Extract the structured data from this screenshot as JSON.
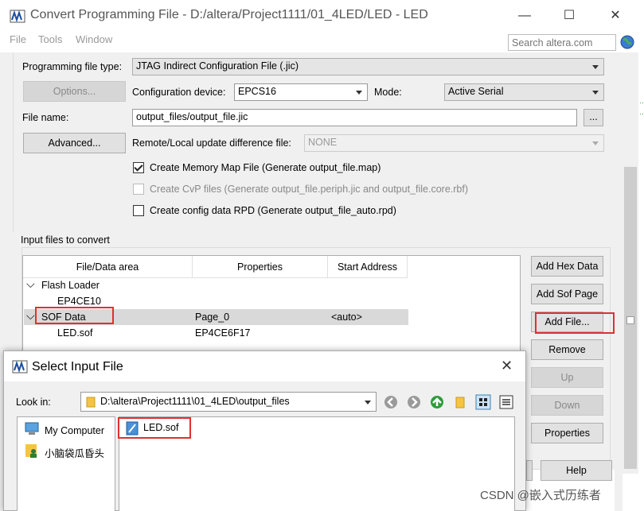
{
  "window": {
    "title": "Convert Programming File - D:/altera/Project1111/01_4LED/LED - LED",
    "minimize": "—",
    "maximize": "☐",
    "close": "✕"
  },
  "menu": {
    "file": "File",
    "tools": "Tools",
    "window": "Window",
    "search_placeholder": "Search altera.com"
  },
  "output": {
    "programming_file_type_label": "Programming file type:",
    "programming_file_type_value": "JTAG Indirect Configuration File (.jic)",
    "options_button": "Options...",
    "config_device_label": "Configuration device:",
    "config_device_value": "EPCS16",
    "mode_label": "Mode:",
    "mode_value": "Active Serial",
    "file_name_label": "File name:",
    "file_name_value": "output_files/output_file.jic",
    "browse_button": "...",
    "advanced_button": "Advanced...",
    "remote_label": "Remote/Local update difference file:",
    "remote_value": "NONE",
    "chk_memory_map": "Create Memory Map File (Generate output_file.map)",
    "chk_cvp": "Create CvP files (Generate output_file.periph.jic and output_file.core.rbf)",
    "chk_rpd": "Create config data RPD (Generate output_file_auto.rpd)"
  },
  "input": {
    "group_label": "Input files to convert",
    "columns": [
      "File/Data area",
      "Properties",
      "Start Address"
    ],
    "rows": [
      {
        "name": "Flash Loader",
        "props": "",
        "addr": "",
        "expand": "⌵"
      },
      {
        "name": "EP4CE10",
        "props": "",
        "addr": ""
      },
      {
        "name": "SOF Data",
        "props": "Page_0",
        "addr": "<auto>",
        "expand": "⌵"
      },
      {
        "name": "LED.sof",
        "props": "EP4CE6F17",
        "addr": ""
      }
    ],
    "buttons": {
      "add_hex": "Add Hex Data",
      "add_sof_page": "Add Sof Page",
      "add_file": "Add File...",
      "remove": "Remove",
      "up": "Up",
      "down": "Down",
      "properties": "Properties",
      "help": "Help"
    }
  },
  "dialog": {
    "title": "Select Input File",
    "close": "✕",
    "look_in_label": "Look in:",
    "look_in_value": "D:\\altera\\Project1111\\01_4LED\\output_files",
    "places": [
      "My Computer",
      "小脑袋瓜昏头"
    ],
    "files": [
      "LED.sof"
    ]
  },
  "watermark": "CSDN @嵌入式历练者",
  "colors": {
    "highlight_box": "#e03030",
    "selected_row": "#d9d9d9",
    "panel": "#f0f0f0"
  }
}
